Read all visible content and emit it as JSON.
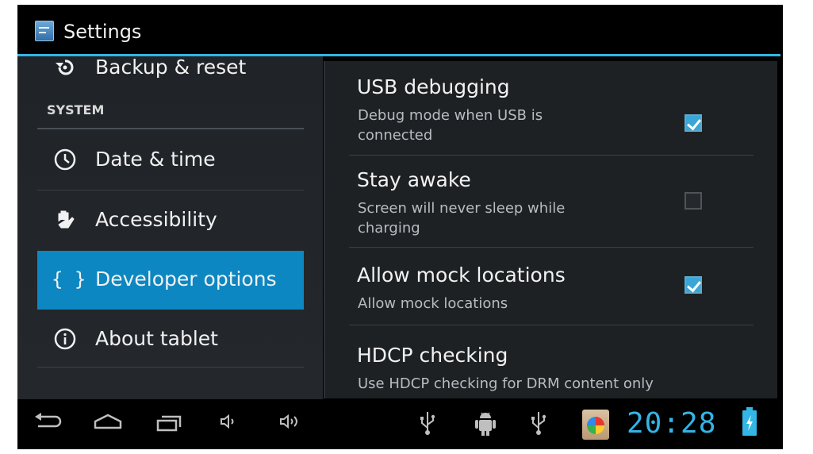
{
  "app": {
    "title": "Settings"
  },
  "sidebar": {
    "partial_item": "Backup & reset",
    "section_header": "SYSTEM",
    "items": [
      {
        "label": "Date & time",
        "icon": "clock-icon",
        "selected": false
      },
      {
        "label": "Accessibility",
        "icon": "hand-icon",
        "selected": false
      },
      {
        "label": "Developer options",
        "icon": "braces-icon",
        "selected": true
      },
      {
        "label": "About tablet",
        "icon": "info-icon",
        "selected": false
      }
    ]
  },
  "preferences": [
    {
      "title": "USB debugging",
      "summary": "Debug mode when USB is connected",
      "checked": true
    },
    {
      "title": "Stay awake",
      "summary": "Screen will never sleep while charging",
      "checked": false
    },
    {
      "title": "Allow mock locations",
      "summary": "Allow mock locations",
      "checked": true
    },
    {
      "title": "HDCP checking",
      "summary": "Use HDCP checking for DRM content only"
    }
  ],
  "status_bar": {
    "time": "20:28",
    "icons": [
      "usb-icon",
      "android-debug-icon",
      "usb-icon",
      "app-notification-icon",
      "battery-charging-icon"
    ]
  },
  "navigation_bar": {
    "buttons": [
      "back-icon",
      "home-icon",
      "recent-apps-icon",
      "volume-down-icon",
      "volume-up-icon"
    ]
  },
  "colors": {
    "accent": "#33b5e5",
    "selected_item": "#0d87c1",
    "background": "#000000",
    "pane_background": "#1e2124"
  }
}
